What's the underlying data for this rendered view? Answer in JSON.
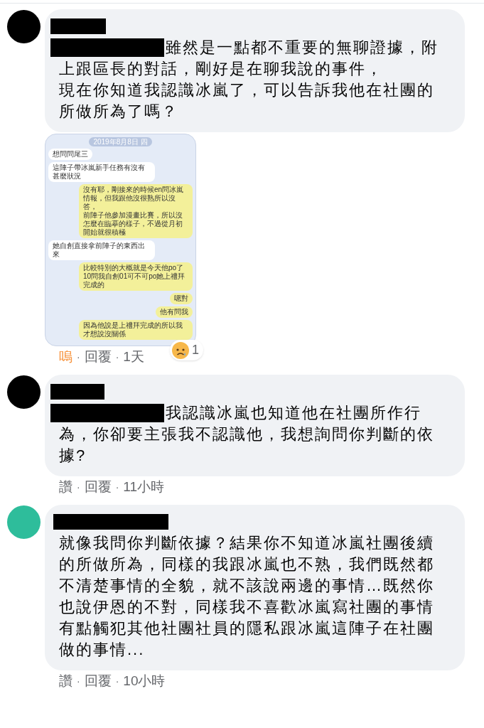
{
  "comments": [
    {
      "avatar": {
        "color": "#000000"
      },
      "author": {
        "redacted": true
      },
      "mention": {
        "redacted": true
      },
      "lines": [
        "雖然是一點都不重要的無聊證據，附",
        "上跟區長的對話，剛好是在聊我說的事件，",
        "現在你知道我認識冰嵐了，可以告訴我他在社團的",
        "所做所為了嗎？"
      ],
      "attachment": {
        "date": "2019年8月8日 四",
        "messages": [
          {
            "kind": "left",
            "lines": [
              "想問問尾三"
            ]
          },
          {
            "kind": "left",
            "lines": [
              "這陣子帶冰嵐新手任務有沒有甚麼狀況"
            ]
          },
          {
            "kind": "right",
            "lines": [
              "沒有耶，剛接來的時候en問冰嵐情報，但我跟他沒很熟所以沒答，",
              "前陣子他參加漫畫比賽，所以沒怎麼在臨摹的樣子，不過從月初開始就很積極"
            ]
          },
          {
            "kind": "left",
            "lines": [
              "她自創直接拿前陣子的東西出來"
            ]
          },
          {
            "kind": "right",
            "lines": [
              "比較特別的大概就是今天他po了10問我自創01可不可po她上禮拜完成的"
            ]
          },
          {
            "kind": "right",
            "lines": [
              "嗯對"
            ]
          },
          {
            "kind": "right",
            "lines": [
              "他有問我"
            ]
          },
          {
            "kind": "right",
            "lines": [
              "因為他說是上禮拜完成的所以我才想說沒關係"
            ]
          }
        ]
      },
      "reaction": {
        "count": "1"
      },
      "actions": [
        {
          "kind": "like",
          "text": "嗚",
          "active": true
        },
        {
          "kind": "separator",
          "text": "·"
        },
        {
          "kind": "reply",
          "text": "回覆"
        },
        {
          "kind": "separator",
          "text": "·"
        },
        {
          "kind": "time",
          "text": "1天"
        }
      ]
    },
    {
      "avatar": {
        "color": "#000000"
      },
      "author": {
        "redacted": true
      },
      "mention": {
        "redacted": true
      },
      "lines": [
        "我認識冰嵐也知道他在社團所作行",
        "為，你卻要主張我不認識他，我想詢問你判斷的依",
        "據?"
      ],
      "actions": [
        {
          "kind": "like",
          "text": "讚",
          "active": false
        },
        {
          "kind": "separator",
          "text": "·"
        },
        {
          "kind": "reply",
          "text": "回覆"
        },
        {
          "kind": "separator",
          "text": "·"
        },
        {
          "kind": "time",
          "text": "11小時"
        }
      ]
    },
    {
      "avatar": {
        "color": "#2ebd9b"
      },
      "author": {
        "redacted": true
      },
      "lines": [
        "就像我問你判斷依據？結果你不知道冰嵐社團後續",
        "的所做所為，同樣的我跟冰嵐也不熟，我們既然都",
        "不清楚事情的全貌，就不該說兩邊的事情…既然你",
        "也說伊恩的不對，同樣我不喜歡冰嵐寫社團的事情",
        "有點觸犯其他社團社員的隱私跟冰嵐這陣子在社團",
        "做的事情..."
      ],
      "actions": [
        {
          "kind": "like",
          "text": "讚",
          "active": false
        },
        {
          "kind": "separator",
          "text": "·"
        },
        {
          "kind": "reply",
          "text": "回覆"
        },
        {
          "kind": "separator",
          "text": "·"
        },
        {
          "kind": "time",
          "text": "10小時"
        }
      ]
    }
  ]
}
